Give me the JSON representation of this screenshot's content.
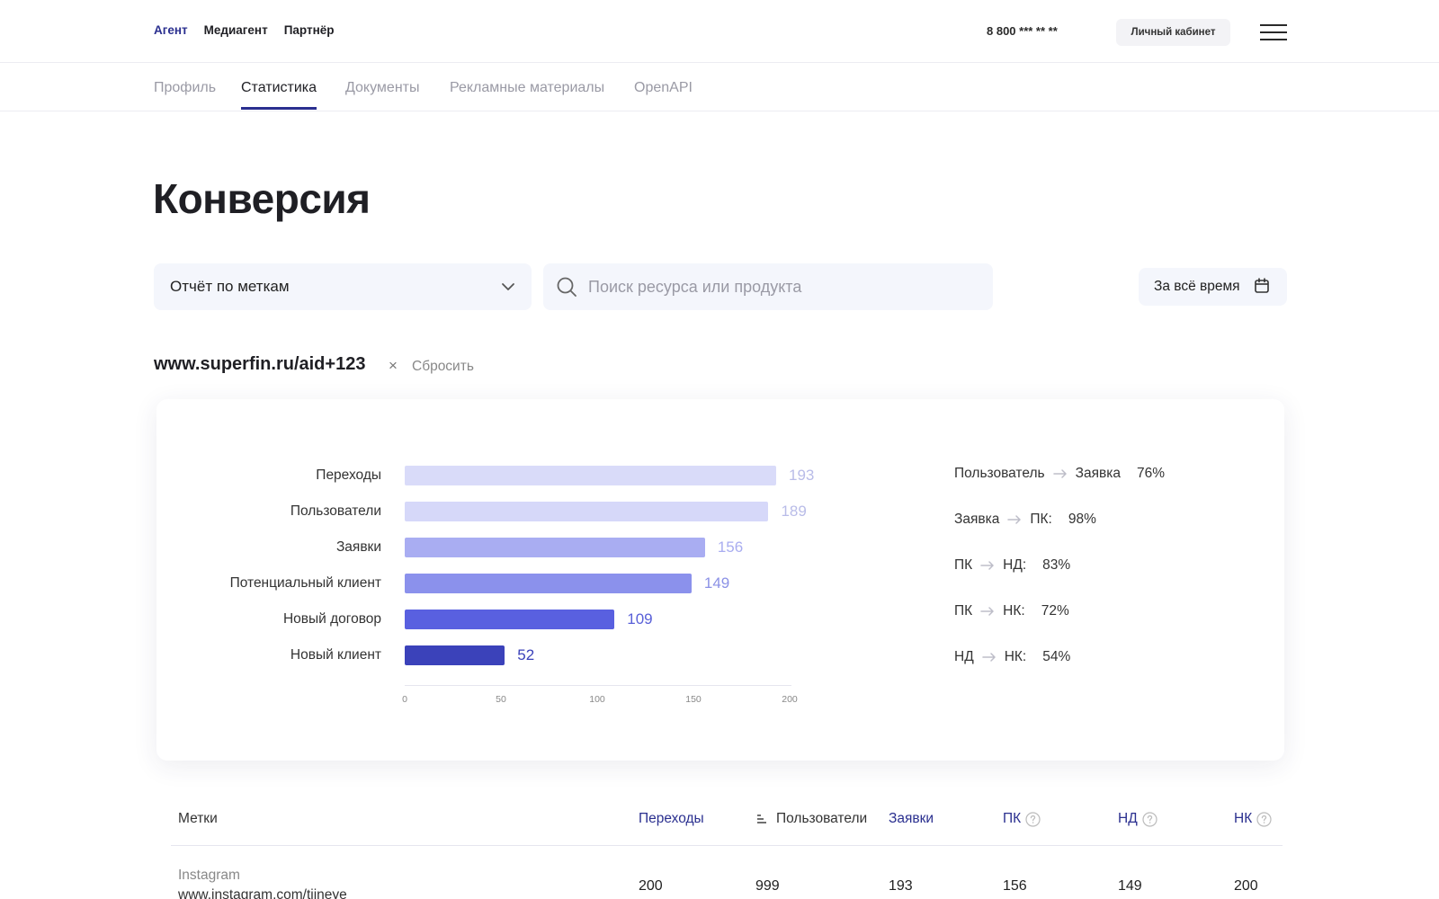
{
  "header": {
    "roles": [
      "Агент",
      "Медиагент",
      "Партнёр"
    ],
    "active_role": "Агент",
    "phone": "8 800 *** ** **",
    "cabinet_label": "Личный кабинет"
  },
  "tabs": [
    {
      "label": "Профиль"
    },
    {
      "label": "Статистика",
      "active": true
    },
    {
      "label": "Документы"
    },
    {
      "label": "Рекламные материалы"
    },
    {
      "label": "OpenAPI"
    }
  ],
  "page": {
    "title": "Конверсия"
  },
  "filters": {
    "report_select": "Отчёт по меткам",
    "search_placeholder": "Поиск ресурса или продукта",
    "period": "За всё время"
  },
  "tag": {
    "url": "www.superfin.ru/aid+123",
    "close_glyph": "×",
    "reset_label": "Сбросить"
  },
  "chart_data": {
    "type": "bar",
    "orientation": "horizontal",
    "categories": [
      "Переходы",
      "Пользователи",
      "Заявки",
      "Потенциальный клиент",
      "Новый договор",
      "Новый клиент"
    ],
    "values": [
      193,
      189,
      156,
      149,
      109,
      52
    ],
    "colors": [
      "#d9dbf9",
      "#d6d8f9",
      "#a9adf2",
      "#8b91ec",
      "#5960e0",
      "#3b42ba"
    ],
    "value_colors": [
      "#b9bce8",
      "#b9bce8",
      "#a9adf0",
      "#8b91e6",
      "#5960d8",
      "#3b42ba"
    ],
    "xlim": [
      0,
      200
    ],
    "ticks": [
      0,
      50,
      100,
      150,
      200
    ],
    "tick_labels": [
      "0",
      "50",
      "100",
      "150",
      "200"
    ]
  },
  "conversions": [
    {
      "from": "Пользователь",
      "to": "Заявка",
      "value": "76%"
    },
    {
      "from": "Заявка",
      "to": "ПК:",
      "value": "98%"
    },
    {
      "from": "ПК",
      "to": "НД:",
      "value": "83%"
    },
    {
      "from": "ПК",
      "to": "НК:",
      "value": "72%"
    },
    {
      "from": "НД",
      "to": "НК:",
      "value": "54%"
    }
  ],
  "table": {
    "headers": {
      "tags": "Метки",
      "clicks": "Переходы",
      "users": "Пользователи",
      "applications": "Заявки",
      "pk": "ПК",
      "nd": "НД",
      "nk": "НК"
    },
    "rows": [
      {
        "name": "Instagram",
        "sub": "www.instagram.com/tiineye",
        "clicks": "200",
        "users": "999",
        "applications": "193",
        "pk": "156",
        "nd": "149",
        "nk": "200"
      }
    ]
  },
  "colors": {
    "accent": "#2a2f8f",
    "input_bg": "#f4f6fc"
  }
}
